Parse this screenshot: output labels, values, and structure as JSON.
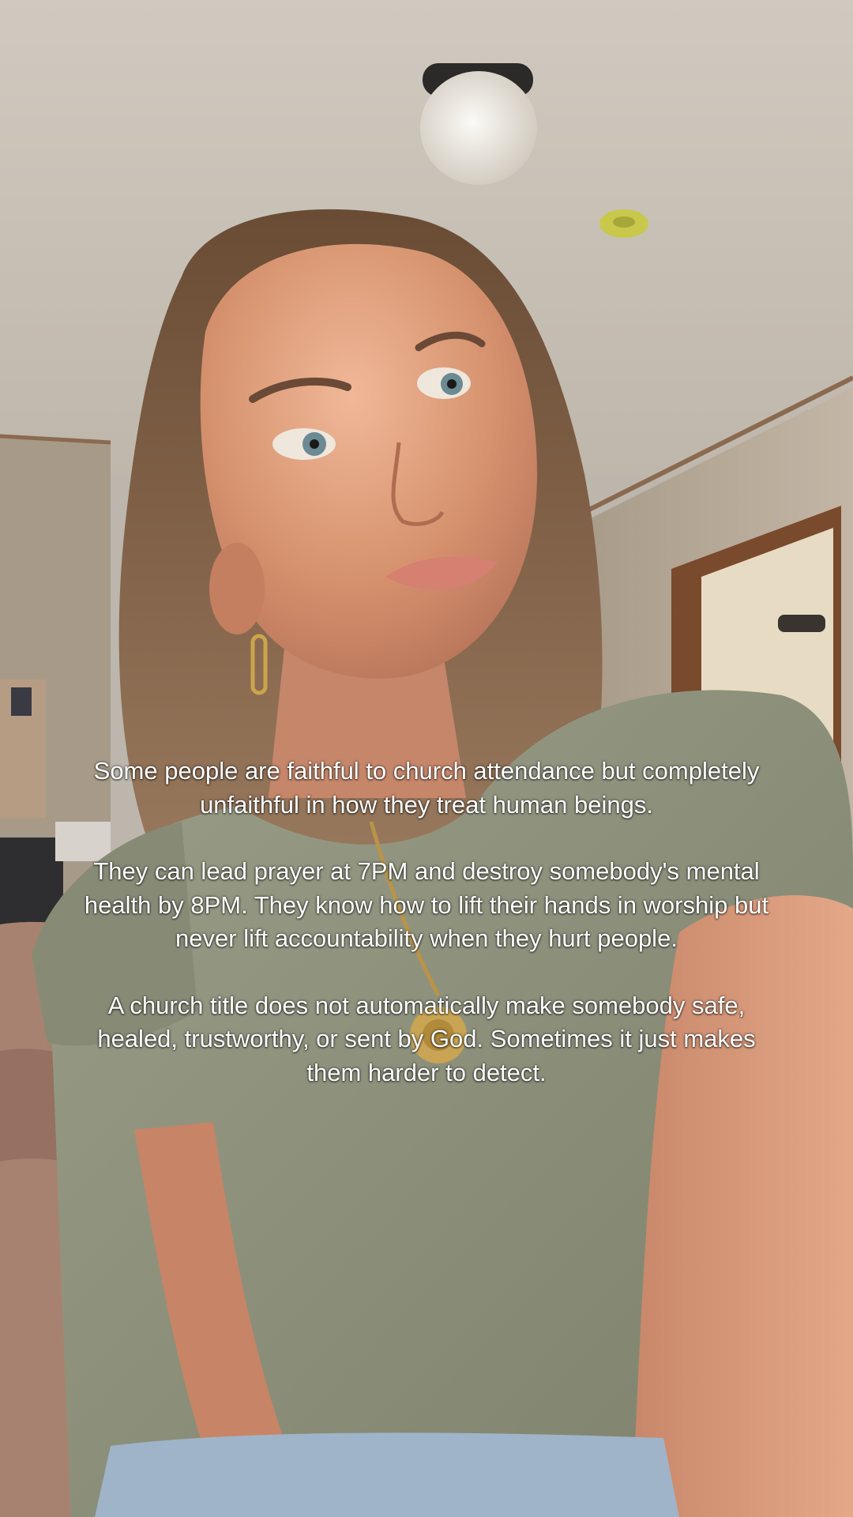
{
  "colors": {
    "ceiling": "#c8c2b8",
    "wall": "#b8ab9c",
    "door_frame": "#7a4a2c",
    "doorway_light": "#e9dcc6",
    "hair": "#7a5a3e",
    "skin": "#d99a78",
    "shirt": "#8a8e78",
    "bedding": "#a88270",
    "jeans": "#9fb4c8",
    "caption_text": "#ffffff"
  },
  "caption": {
    "paragraph_1": "Some people are faithful to church attendance but completely unfaithful in how they treat human beings.",
    "paragraph_2": "They can lead prayer at 7PM and destroy somebody's mental health by 8PM. They know how to lift their hands in worship but never lift accountability when they hurt people.",
    "paragraph_3": "A church title does not automatically make somebody safe, healed, trustworthy, or sent by God. Sometimes it just makes them harder to detect."
  }
}
